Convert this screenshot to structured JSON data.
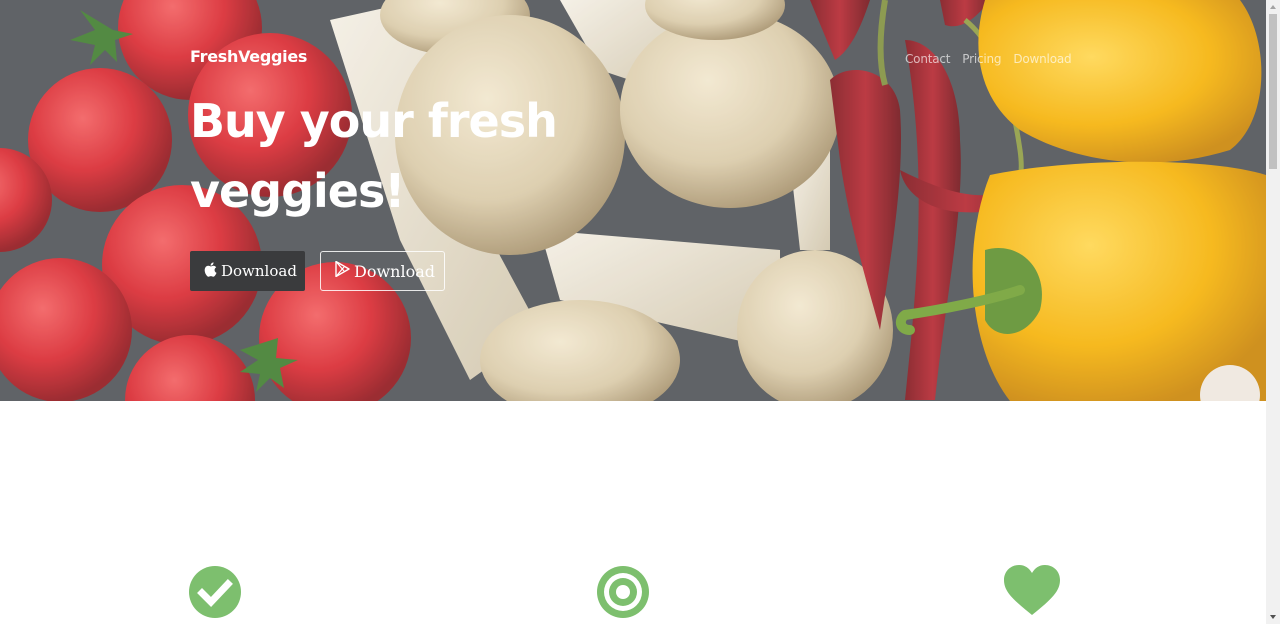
{
  "header": {
    "brand": "FreshVeggies",
    "nav": [
      "Contact",
      "Pricing",
      "Download"
    ]
  },
  "hero": {
    "headline": "Buy your fresh veggies!",
    "buttons": [
      {
        "label": "Download",
        "icon": "apple-icon"
      },
      {
        "label": "Download",
        "icon": "play-store-icon"
      }
    ]
  },
  "features": {
    "icons": [
      "check-circle-icon",
      "target-icon",
      "heart-icon"
    ],
    "accent_color": "#7dbf6e"
  },
  "colors": {
    "hero_button_dark": "#3a3b3d",
    "tomato": "#d8222a",
    "pepper_yellow": "#f5b000",
    "mushroom": "#d9c9a6"
  }
}
